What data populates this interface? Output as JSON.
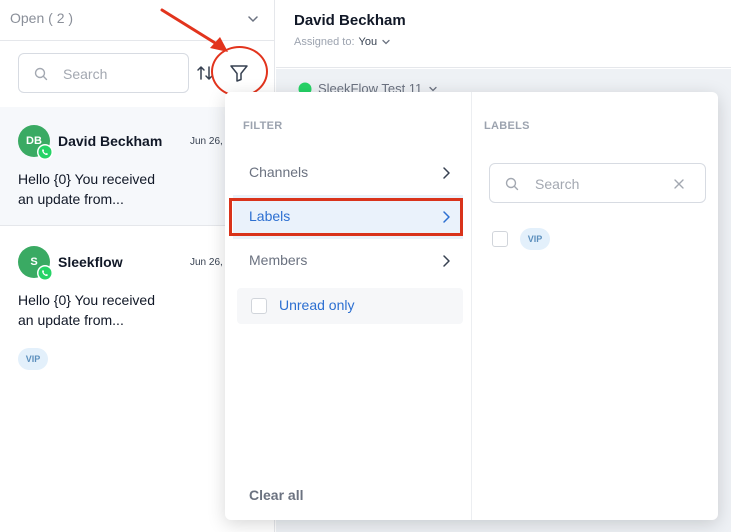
{
  "inbox": {
    "status_label": "Open ( 2 )",
    "search_placeholder": "Search",
    "conversations": [
      {
        "initials": "DB",
        "name": "David Beckham",
        "date": "Jun 26,",
        "preview_line1": "Hello {0} You received",
        "preview_line2": "an update from...",
        "tags": []
      },
      {
        "initials": "S",
        "name": "Sleekflow",
        "date": "Jun 26,",
        "preview_line1": "Hello {0} You received",
        "preview_line2": "an update from...",
        "tags": [
          "VIP"
        ]
      }
    ]
  },
  "chat": {
    "contact_name": "David Beckham",
    "assigned_label": "Assigned to:",
    "assignee": "You",
    "channel_name": "SleekFlow Test 11"
  },
  "filter_dropdown": {
    "filter_heading": "FILTER",
    "labels_heading": "LABELS",
    "menu_items": [
      {
        "label": "Channels"
      },
      {
        "label": "Labels"
      },
      {
        "label": "Members"
      }
    ],
    "unread_only_label": "Unread only",
    "clear_all_label": "Clear all",
    "label_search_placeholder": "Search",
    "label_options": [
      "VIP"
    ]
  },
  "colors": {
    "accent_blue": "#2c6fd1",
    "whatsapp_green": "#25d366",
    "avatar_green": "#3aaa63",
    "annotation_red": "#e2341d"
  }
}
